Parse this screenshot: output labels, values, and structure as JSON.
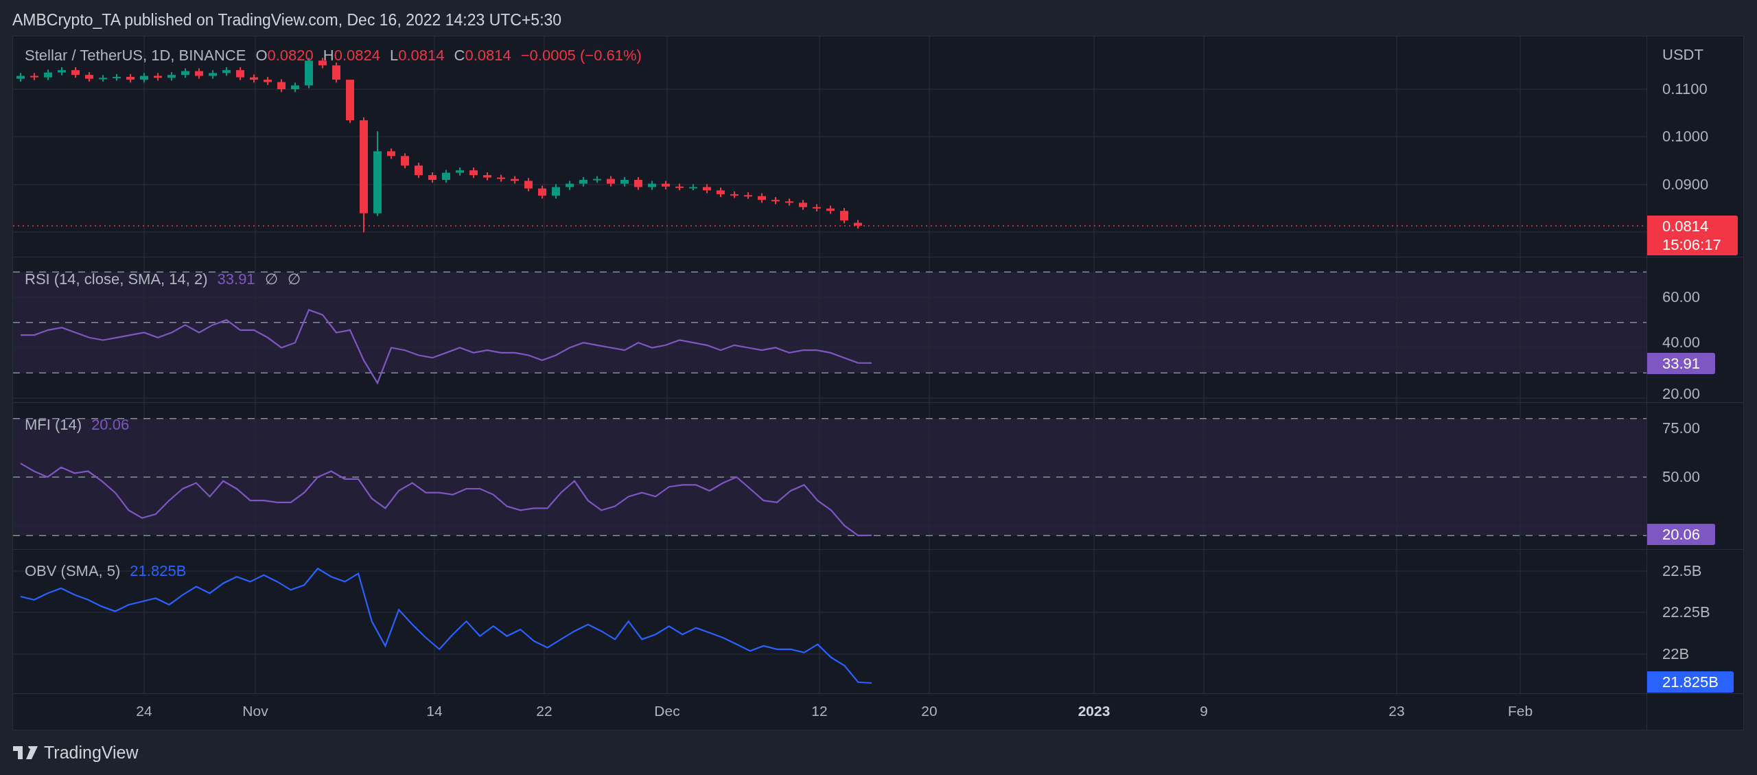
{
  "header": {
    "publisher_line": "AMBCrypto_TA published on TradingView.com, Dec 16, 2022 14:23 UTC+5:30"
  },
  "main_pane": {
    "symbol": "Stellar / TetherUS, 1D, BINANCE",
    "ohlc": [
      {
        "label": "O",
        "value": "0.0820"
      },
      {
        "label": "H",
        "value": "0.0824"
      },
      {
        "label": "L",
        "value": "0.0814"
      },
      {
        "label": "C",
        "value": "0.0814"
      }
    ],
    "change": "−0.0005 (−0.61%)",
    "axis_unit": "USDT",
    "axis_labels": [
      "0.1100",
      "0.1000",
      "0.0900"
    ],
    "price_tag": {
      "price": "0.0814",
      "countdown": "15:06:17"
    }
  },
  "rsi_pane": {
    "title": "RSI (14, close, SMA, 14, 2)",
    "value": "33.91",
    "extra_values": [
      "∅",
      "∅"
    ],
    "axis_labels": [
      "60.00",
      "40.00",
      "20.00"
    ],
    "value_tag": "33.91"
  },
  "mfi_pane": {
    "title": "MFI (14)",
    "value": "20.06",
    "axis_labels": [
      "75.00",
      "50.00"
    ],
    "value_tag": "20.06"
  },
  "obv_pane": {
    "title": "OBV (SMA, 5)",
    "value": "21.825B",
    "axis_labels": [
      "22.5B",
      "22.25B",
      "22B"
    ],
    "value_tag": "21.825B"
  },
  "time_axis": [
    {
      "label": "24",
      "kind": "date"
    },
    {
      "label": "Nov",
      "kind": "date"
    },
    {
      "label": "14",
      "kind": "date"
    },
    {
      "label": "22",
      "kind": "date"
    },
    {
      "label": "Dec",
      "kind": "date"
    },
    {
      "label": "12",
      "kind": "date"
    },
    {
      "label": "20",
      "kind": "date"
    },
    {
      "label": "2023",
      "kind": "year"
    },
    {
      "label": "9",
      "kind": "date"
    },
    {
      "label": "23",
      "kind": "date"
    },
    {
      "label": "Feb",
      "kind": "date"
    }
  ],
  "footer": {
    "brand": "TradingView"
  }
}
